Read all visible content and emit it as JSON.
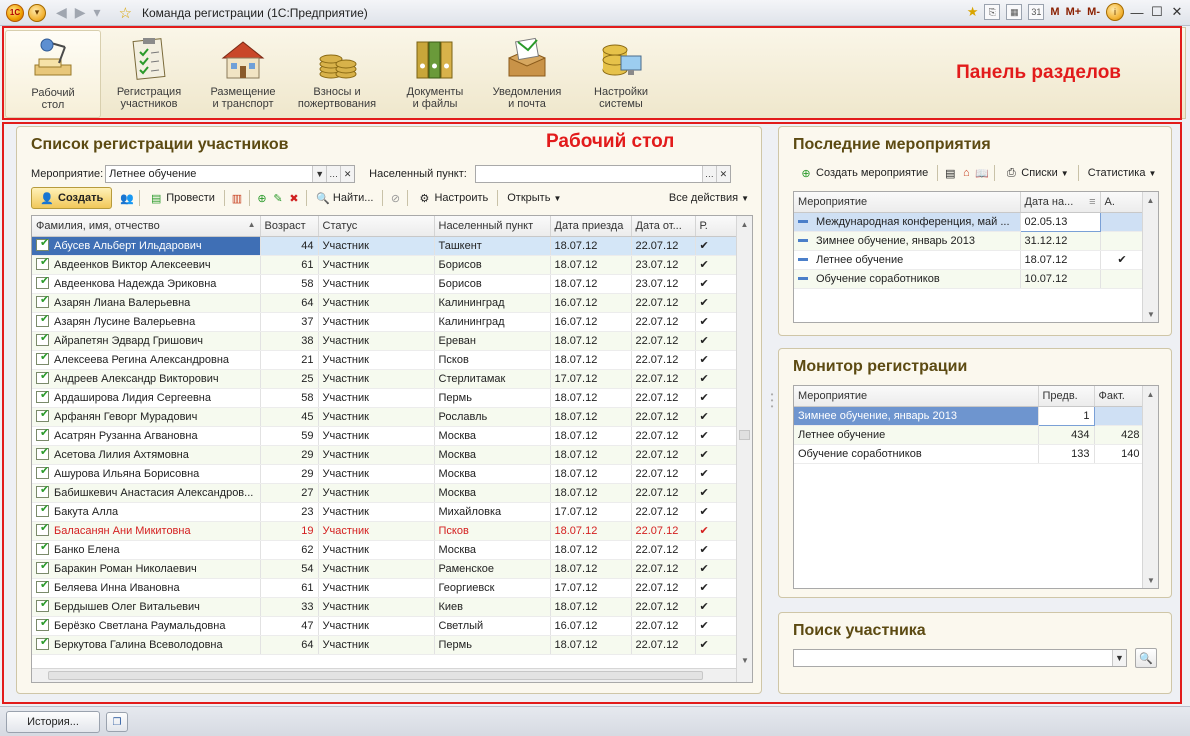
{
  "window": {
    "title": "Команда регистрации  (1С:Предприятие)",
    "logo": "1С",
    "mem_buttons": [
      "M",
      "M+",
      "M-"
    ]
  },
  "sections": {
    "annotation": "Панель разделов",
    "items": [
      {
        "label": "Рабочий\nстол",
        "icon": "desk-lamp-icon"
      },
      {
        "label": "Регистрация\nучастников",
        "icon": "clipboard-checklist-icon"
      },
      {
        "label": "Размещение\nи транспорт",
        "icon": "house-icon"
      },
      {
        "label": "Взносы и\nпожертвования",
        "icon": "coins-icon"
      },
      {
        "label": "Документы\nи файлы",
        "icon": "binders-icon"
      },
      {
        "label": "Уведомления\nи почта",
        "icon": "mail-box-icon"
      },
      {
        "label": "Настройки\nсистемы",
        "icon": "database-monitor-icon"
      }
    ]
  },
  "workspace_annotation": "Рабочий стол",
  "registration_list": {
    "title": "Список регистрации участников",
    "event_label": "Мероприятие:",
    "event_value": "Летнее обучение",
    "city_label": "Населенный пункт:",
    "city_value": "",
    "toolbar": {
      "create": "Создать",
      "post": "Провести",
      "find": "Найти...",
      "customize": "Настроить",
      "open": "Открыть",
      "all_actions": "Все действия"
    },
    "columns": [
      "Фамилия, имя, отчество",
      "Возраст",
      "Статус",
      "Населенный пункт",
      "Дата приезда",
      "Дата от...",
      "Р."
    ],
    "rows": [
      {
        "name": "Абусев Альберт Ильдарович",
        "age": "44",
        "status": "Участник",
        "city": "Ташкент",
        "arrive": "18.07.12",
        "depart": "22.07.12",
        "r": "✔",
        "state": "selected"
      },
      {
        "name": "Авдеенков Виктор Алексеевич",
        "age": "61",
        "status": "Участник",
        "city": "Борисов",
        "arrive": "18.07.12",
        "depart": "23.07.12",
        "r": "✔",
        "state": ""
      },
      {
        "name": "Авдеенкова Надежда Эриковна",
        "age": "58",
        "status": "Участник",
        "city": "Борисов",
        "arrive": "18.07.12",
        "depart": "23.07.12",
        "r": "✔",
        "state": ""
      },
      {
        "name": "Азарян Лиана Валерьевна",
        "age": "64",
        "status": "Участник",
        "city": "Калининград",
        "arrive": "16.07.12",
        "depart": "22.07.12",
        "r": "✔",
        "state": ""
      },
      {
        "name": "Азарян Лусине Валерьевна",
        "age": "37",
        "status": "Участник",
        "city": "Калининград",
        "arrive": "16.07.12",
        "depart": "22.07.12",
        "r": "✔",
        "state": ""
      },
      {
        "name": "Айрапетян Эдвард Гришович",
        "age": "38",
        "status": "Участник",
        "city": "Ереван",
        "arrive": "18.07.12",
        "depart": "22.07.12",
        "r": "✔",
        "state": ""
      },
      {
        "name": "Алексеева Регина Александровна",
        "age": "21",
        "status": "Участник",
        "city": "Псков",
        "arrive": "18.07.12",
        "depart": "22.07.12",
        "r": "✔",
        "state": ""
      },
      {
        "name": "Андреев Александр Викторович",
        "age": "25",
        "status": "Участник",
        "city": "Стерлитамак",
        "arrive": "17.07.12",
        "depart": "22.07.12",
        "r": "✔",
        "state": ""
      },
      {
        "name": "Ардаширова Лидия Сергеевна",
        "age": "58",
        "status": "Участник",
        "city": "Пермь",
        "arrive": "18.07.12",
        "depart": "22.07.12",
        "r": "✔",
        "state": ""
      },
      {
        "name": "Арфанян Геворг Мурадович",
        "age": "45",
        "status": "Участник",
        "city": "Рославль",
        "arrive": "18.07.12",
        "depart": "22.07.12",
        "r": "✔",
        "state": ""
      },
      {
        "name": "Асатрян Рузанна Агвановна",
        "age": "59",
        "status": "Участник",
        "city": "Москва",
        "arrive": "18.07.12",
        "depart": "22.07.12",
        "r": "✔",
        "state": ""
      },
      {
        "name": "Асетова Лилия Ахтямовна",
        "age": "29",
        "status": "Участник",
        "city": "Москва",
        "arrive": "18.07.12",
        "depart": "22.07.12",
        "r": "✔",
        "state": ""
      },
      {
        "name": "Ашурова Ильяна Борисовна",
        "age": "29",
        "status": "Участник",
        "city": "Москва",
        "arrive": "18.07.12",
        "depart": "22.07.12",
        "r": "✔",
        "state": ""
      },
      {
        "name": "Бабишкевич Анастасия Александров...",
        "age": "27",
        "status": "Участник",
        "city": "Москва",
        "arrive": "18.07.12",
        "depart": "22.07.12",
        "r": "✔",
        "state": ""
      },
      {
        "name": "Бакута Алла",
        "age": "23",
        "status": "Участник",
        "city": "Михайловка",
        "arrive": "17.07.12",
        "depart": "22.07.12",
        "r": "✔",
        "state": ""
      },
      {
        "name": "Баласанян Ани Микитовна",
        "age": "19",
        "status": "Участник",
        "city": "Псков",
        "arrive": "18.07.12",
        "depart": "22.07.12",
        "r": "✔",
        "state": "red"
      },
      {
        "name": "Банко Елена",
        "age": "62",
        "status": "Участник",
        "city": "Москва",
        "arrive": "18.07.12",
        "depart": "22.07.12",
        "r": "✔",
        "state": ""
      },
      {
        "name": "Баракин Роман Николаевич",
        "age": "54",
        "status": "Участник",
        "city": "Раменское",
        "arrive": "18.07.12",
        "depart": "22.07.12",
        "r": "✔",
        "state": ""
      },
      {
        "name": "Беляева Инна Ивановна",
        "age": "61",
        "status": "Участник",
        "city": "Георгиевск",
        "arrive": "17.07.12",
        "depart": "22.07.12",
        "r": "✔",
        "state": ""
      },
      {
        "name": "Бердышев Олег Витальевич",
        "age": "33",
        "status": "Участник",
        "city": "Киев",
        "arrive": "18.07.12",
        "depart": "22.07.12",
        "r": "✔",
        "state": ""
      },
      {
        "name": "Берёзко Светлана Раумальдовна",
        "age": "47",
        "status": "Участник",
        "city": "Светлый",
        "arrive": "16.07.12",
        "depart": "22.07.12",
        "r": "✔",
        "state": ""
      },
      {
        "name": "Беркутова Галина Всеволодовна",
        "age": "64",
        "status": "Участник",
        "city": "Пермь",
        "arrive": "18.07.12",
        "depart": "22.07.12",
        "r": "✔",
        "state": ""
      }
    ]
  },
  "recent_events": {
    "title": "Последние мероприятия",
    "toolbar": {
      "create": "Создать мероприятие",
      "lists": "Списки",
      "stats": "Статистика"
    },
    "columns": [
      "Мероприятие",
      "Дата на...",
      "А."
    ],
    "rows": [
      {
        "name": "Международная конференция, май ...",
        "date": "02.05.13",
        "a": "",
        "state": "selected"
      },
      {
        "name": "Зимнее обучение, январь 2013",
        "date": "31.12.12",
        "a": "",
        "state": ""
      },
      {
        "name": "Летнее обучение",
        "date": "18.07.12",
        "a": "✔",
        "state": ""
      },
      {
        "name": "Обучение соработников",
        "date": "10.07.12",
        "a": "",
        "state": ""
      }
    ]
  },
  "monitor": {
    "title": "Монитор регистрации",
    "columns": [
      "Мероприятие",
      "Предв.",
      "Факт."
    ],
    "rows": [
      {
        "name": "Зимнее обучение, январь 2013",
        "pre": "1",
        "fact": "",
        "state": "selected"
      },
      {
        "name": "Летнее обучение",
        "pre": "434",
        "fact": "428",
        "state": ""
      },
      {
        "name": "Обучение соработников",
        "pre": "133",
        "fact": "140",
        "state": ""
      }
    ]
  },
  "search": {
    "title": "Поиск участника",
    "value": ""
  },
  "bottom": {
    "history": "История..."
  },
  "colors": {
    "annotation_red": "#e21b1b",
    "panel_title": "#5c4a12",
    "selection_blue": "#3f6fb5"
  }
}
